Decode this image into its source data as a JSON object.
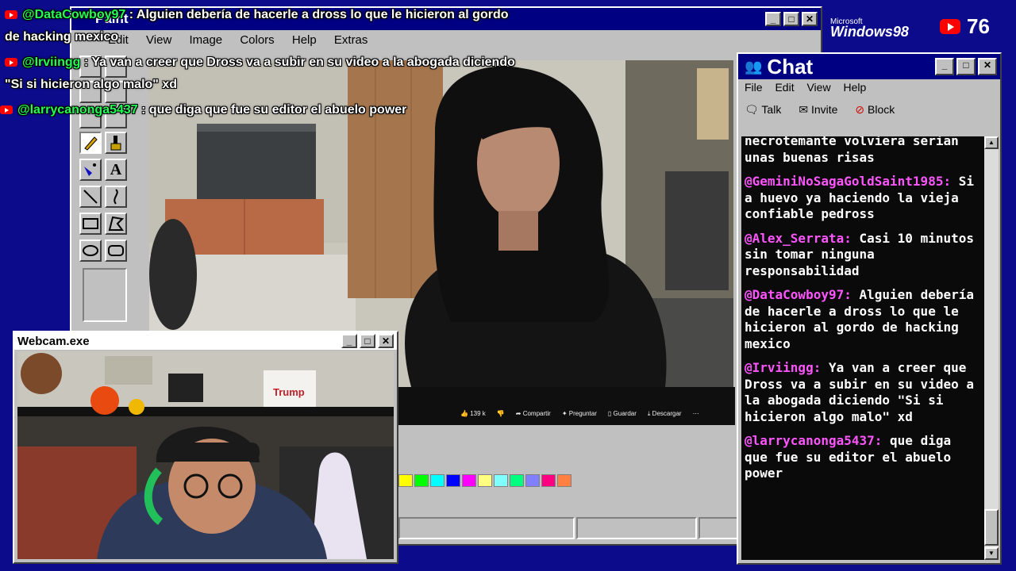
{
  "paint": {
    "title": "Paint",
    "menu": [
      "Edit",
      "View",
      "Image",
      "Colors",
      "Help",
      "Extras"
    ]
  },
  "overlay_messages": [
    {
      "user": "@DataCowboy97",
      "sep": " : ",
      "text": "Alguien debería de hacerle a dross lo que le hicieron al gordo",
      "cont": "de hacking mexico"
    },
    {
      "user": "@Irviingg",
      "sep": " : ",
      "text": "Ya van a creer que Dross va a subir en su video a la abogada diciendo",
      "cont": "\"Si si hicieron algo malo\" xd"
    },
    {
      "user": "@larrycanonga5437",
      "sep": " : ",
      "text": "que diga que fue su editor el abuelo power",
      "cont": ""
    }
  ],
  "branding": {
    "microsoft": "Microsoft",
    "windows": "Windows98"
  },
  "viewer_count": "76",
  "video_actions": [
    {
      "label": "139 k",
      "icon": "thumbs-up-icon"
    },
    {
      "label": "",
      "icon": "thumbs-down-icon"
    },
    {
      "label": "Compartir",
      "icon": "share-icon"
    },
    {
      "label": "Preguntar",
      "icon": "sparkle-icon"
    },
    {
      "label": "Guardar",
      "icon": "bookmark-icon"
    },
    {
      "label": "Descargar",
      "icon": "download-icon"
    }
  ],
  "webcam": {
    "title": "Webcam.exe",
    "shelf_sign": "Trump"
  },
  "chat": {
    "title": "Chat",
    "menu": [
      "File",
      "Edit",
      "View",
      "Help"
    ],
    "toolbar": [
      {
        "label": "Talk",
        "icon": "talk-icon"
      },
      {
        "label": "Invite",
        "icon": "invite-icon"
      },
      {
        "label": "Block",
        "icon": "block-icon"
      }
    ],
    "messages": [
      {
        "user": "",
        "text": "necrotemante volviera serian unas buenas risas"
      },
      {
        "user": "@GeminiNoSagaGoldSaint1985:",
        "text": "Si a huevo ya haciendo la vieja confiable pedross"
      },
      {
        "user": "@Alex_Serrata:",
        "text": "Casi 10 minutos sin tomar ninguna responsabilidad"
      },
      {
        "user": "@DataCowboy97:",
        "text": "Alguien debería de hacerle a dross lo que le hicieron al gordo de hacking mexico"
      },
      {
        "user": "@Irviingg:",
        "text": "Ya van a creer que Dross va a subir en su video a la abogada diciendo \"Si si hicieron algo malo\" xd"
      },
      {
        "user": "@larrycanonga5437:",
        "text": "que diga que fue su editor el abuelo power"
      }
    ]
  },
  "palette": [
    "#ffff00",
    "#00ff00",
    "#00ffff",
    "#0000ff",
    "#ff00ff",
    "#ffff80",
    "#80ffff",
    "#00ff80",
    "#8080ff",
    "#ff0080",
    "#ff8040"
  ],
  "colors": {
    "desktop": "#0b0b8c",
    "titlebar": "#000082",
    "chat_username": "#ff55ff",
    "overlay_username": "#22ff55",
    "youtube_red": "#ff0000"
  }
}
